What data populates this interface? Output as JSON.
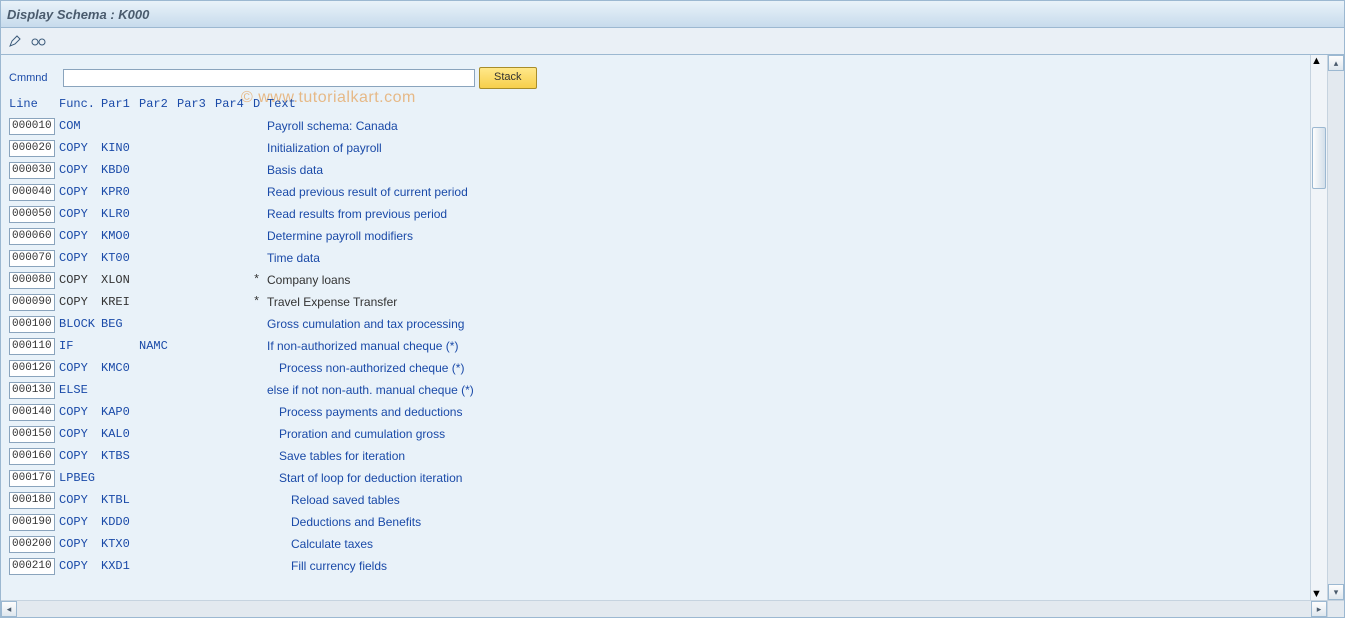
{
  "title": "Display  Schema : K000",
  "watermark": "© www.tutorialkart.com",
  "command": {
    "label": "Cmmnd",
    "value": "",
    "stack_label": "Stack"
  },
  "columns": {
    "line": "Line",
    "func": "Func.",
    "par1": "Par1",
    "par2": "Par2",
    "par3": "Par3",
    "par4": "Par4",
    "d": "D",
    "text": "Text"
  },
  "rows": [
    {
      "line": "000010",
      "func": "COM",
      "par1": "",
      "par2": "",
      "d": "",
      "text": "Payroll schema: Canada",
      "link": true,
      "indent": 0
    },
    {
      "line": "000020",
      "func": "COPY",
      "par1": "KIN0",
      "par2": "",
      "d": "",
      "text": "Initialization of payroll",
      "link": true,
      "indent": 0
    },
    {
      "line": "000030",
      "func": "COPY",
      "par1": "KBD0",
      "par2": "",
      "d": "",
      "text": "Basis data",
      "link": true,
      "indent": 0
    },
    {
      "line": "000040",
      "func": "COPY",
      "par1": "KPR0",
      "par2": "",
      "d": "",
      "text": "Read previous result of current period",
      "link": true,
      "indent": 0
    },
    {
      "line": "000050",
      "func": "COPY",
      "par1": "KLR0",
      "par2": "",
      "d": "",
      "text": "Read results from previous period",
      "link": true,
      "indent": 0
    },
    {
      "line": "000060",
      "func": "COPY",
      "par1": "KMO0",
      "par2": "",
      "d": "",
      "text": "Determine payroll modifiers",
      "link": true,
      "indent": 0
    },
    {
      "line": "000070",
      "func": "COPY",
      "par1": "KT00",
      "par2": "",
      "d": "",
      "text": "Time data",
      "link": true,
      "indent": 0
    },
    {
      "line": "000080",
      "func": "COPY",
      "par1": "XLON",
      "par2": "",
      "d": "*",
      "text": "Company loans",
      "link": false,
      "indent": 0
    },
    {
      "line": "000090",
      "func": "COPY",
      "par1": "KREI",
      "par2": "",
      "d": "*",
      "text": "Travel Expense Transfer",
      "link": false,
      "indent": 0
    },
    {
      "line": "000100",
      "func": "BLOCK",
      "par1": "BEG",
      "par2": "",
      "d": "",
      "text": "Gross cumulation and tax processing",
      "link": true,
      "indent": 0
    },
    {
      "line": "000110",
      "func": "IF",
      "par1": "",
      "par2": "NAMC",
      "d": "",
      "text": "If non-authorized manual cheque      (*)",
      "link": true,
      "indent": 0
    },
    {
      "line": "000120",
      "func": "COPY",
      "par1": "KMC0",
      "par2": "",
      "d": "",
      "text": "Process non-authorized cheque      (*)",
      "link": true,
      "indent": 1
    },
    {
      "line": "000130",
      "func": "ELSE",
      "par1": "",
      "par2": "",
      "d": "",
      "text": "else if not non-auth. manual cheque  (*)",
      "link": true,
      "indent": 0
    },
    {
      "line": "000140",
      "func": "COPY",
      "par1": "KAP0",
      "par2": "",
      "d": "",
      "text": "Process payments and deductions",
      "link": true,
      "indent": 1
    },
    {
      "line": "000150",
      "func": "COPY",
      "par1": "KAL0",
      "par2": "",
      "d": "",
      "text": "Proration and cumulation gross",
      "link": true,
      "indent": 1
    },
    {
      "line": "000160",
      "func": "COPY",
      "par1": "KTBS",
      "par2": "",
      "d": "",
      "text": "Save tables for iteration",
      "link": true,
      "indent": 1
    },
    {
      "line": "000170",
      "func": "LPBEG",
      "par1": "",
      "par2": "",
      "d": "",
      "text": "Start of loop for deduction iteration",
      "link": true,
      "indent": 1
    },
    {
      "line": "000180",
      "func": "COPY",
      "par1": "KTBL",
      "par2": "",
      "d": "",
      "text": "Reload saved tables",
      "link": true,
      "indent": 2
    },
    {
      "line": "000190",
      "func": "COPY",
      "par1": "KDD0",
      "par2": "",
      "d": "",
      "text": "Deductions and Benefits",
      "link": true,
      "indent": 2
    },
    {
      "line": "000200",
      "func": "COPY",
      "par1": "KTX0",
      "par2": "",
      "d": "",
      "text": "Calculate taxes",
      "link": true,
      "indent": 2
    },
    {
      "line": "000210",
      "func": "COPY",
      "par1": "KXD1",
      "par2": "",
      "d": "",
      "text": "Fill currency fields",
      "link": true,
      "indent": 2
    }
  ]
}
